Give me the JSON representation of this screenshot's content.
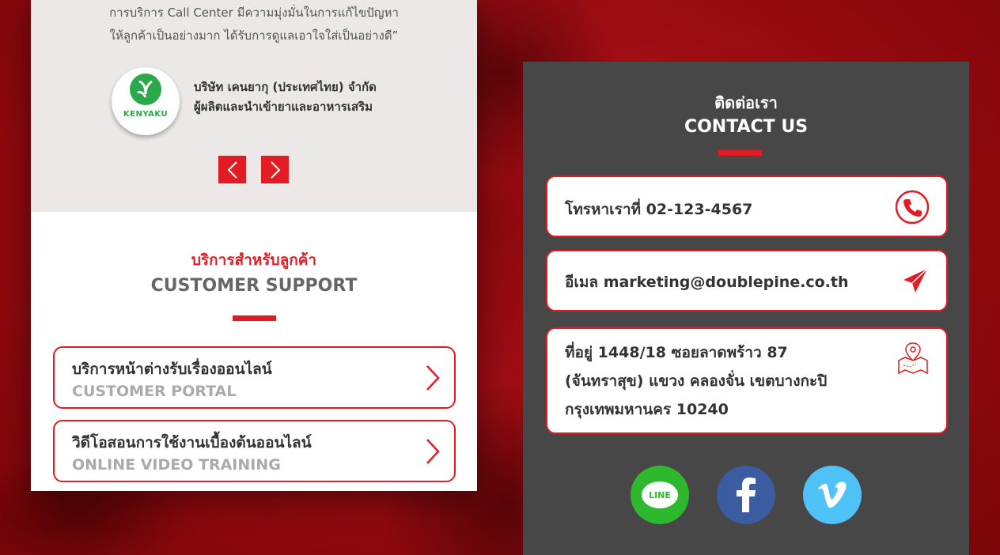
{
  "testimonial": {
    "quote_line1": "การบริการ Call Center มีความมุ่งมั่นในการแก้ไขปัญหา",
    "quote_line2": "ให้ลูกค้าเป็นอย่างมาก ได้รับการดูแลเอาใจใส่เป็นอย่างดี”",
    "logo_text": "KENYAKU",
    "company_line1": "บริษัท เคนยากุ (ประเทศไทย) จำกัด",
    "company_line2": "ผู้ผลิตและนำเข้ายาและอาหารเสริม"
  },
  "support": {
    "subtitle": "บริการสำหรับลูกค้า",
    "title": "CUSTOMER SUPPORT",
    "cards": [
      {
        "th": "บริการหน้าต่างรับเรื่องออนไลน์",
        "en": "CUSTOMER PORTAL"
      },
      {
        "th": "วิดีโอสอนการใช้งานเบื้องต้นออนไลน์",
        "en": "ONLINE  VIDEO TRAINING"
      }
    ]
  },
  "contact": {
    "subtitle": "ติดต่อเรา",
    "title": "CONTACT US",
    "phone": "โทรหาเราที่ 02-123-4567",
    "email": "อีเมล marketing@doublepine.co.th",
    "address_line1": "ที่อยู่ 1448/18 ซอยลาดพร้าว 87",
    "address_line2": "(จันทราสุข) แขวง คลองจั่น เขตบางกะปิ",
    "address_line3": "กรุงเทพมหานคร 10240",
    "social": {
      "line_label": "LINE"
    }
  },
  "colors": {
    "accent": "#e31c24",
    "dark_panel": "#474747",
    "line_green": "#2eb82e",
    "facebook_blue": "#3b5ca0",
    "vimeo_blue": "#4fc3f7"
  },
  "icons": [
    "phone-icon",
    "send-icon",
    "map-icon",
    "chevron-left-icon",
    "chevron-right-icon",
    "line-icon",
    "facebook-icon",
    "vimeo-icon"
  ]
}
